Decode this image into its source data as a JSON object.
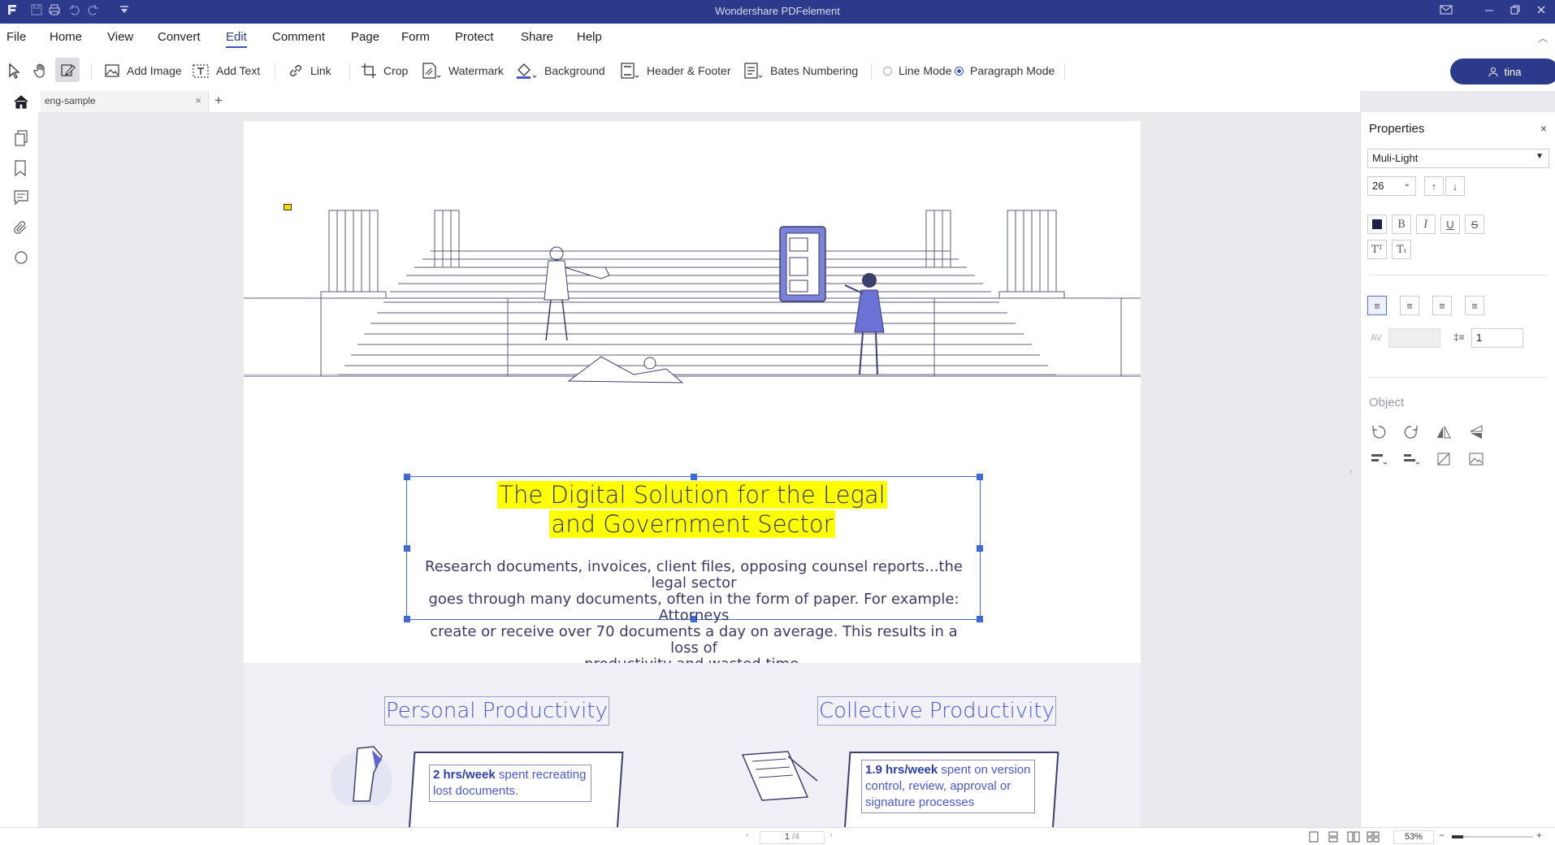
{
  "app": {
    "title": "Wondershare PDFelement"
  },
  "menu": [
    "File",
    "Home",
    "View",
    "Convert",
    "Edit",
    "Comment",
    "Page",
    "Form",
    "Protect",
    "Share",
    "Help"
  ],
  "toolbar": {
    "add_image": "Add Image",
    "add_text": "Add Text",
    "link": "Link",
    "crop": "Crop",
    "watermark": "Watermark",
    "background": "Background",
    "header_footer": "Header & Footer",
    "bates": "Bates Numbering",
    "line_mode": "Line Mode",
    "paragraph_mode": "Paragraph Mode",
    "user": "tina"
  },
  "tab": {
    "name": "eng-sample",
    "close": "×",
    "add": "+"
  },
  "document": {
    "title_line1": "The Digital Solution for the Legal",
    "title_line2": "and Government Sector",
    "para_line1": "Research documents, invoices, client files, opposing counsel reports...the legal sector",
    "para_line2": "goes through many documents, often in the form of paper. For example: Attorneys",
    "para_line3": "create or receive over 70 documents a day on average. This results in a loss of",
    "para_line4": "productivity and wasted time.",
    "section_personal": "Personal Productivity",
    "section_collective": "Collective Productivity",
    "card1_bold": "2 hrs/week",
    "card1_text": " spent recreating lost documents.",
    "card2_bold": "1.9 hrs/week",
    "card2_text": "  spent on version control, review, approval or signature processes"
  },
  "properties": {
    "title": "Properties",
    "close": "×",
    "font": "Muli-Light",
    "size": "26",
    "line_spacing": "1",
    "object_label": "Object"
  },
  "status": {
    "page": "1",
    "page_total": "/4",
    "zoom": "53%"
  },
  "colors": {
    "brand": "#2c3a8c",
    "highlight": "#ffff00",
    "accent": "#4a58cf"
  }
}
